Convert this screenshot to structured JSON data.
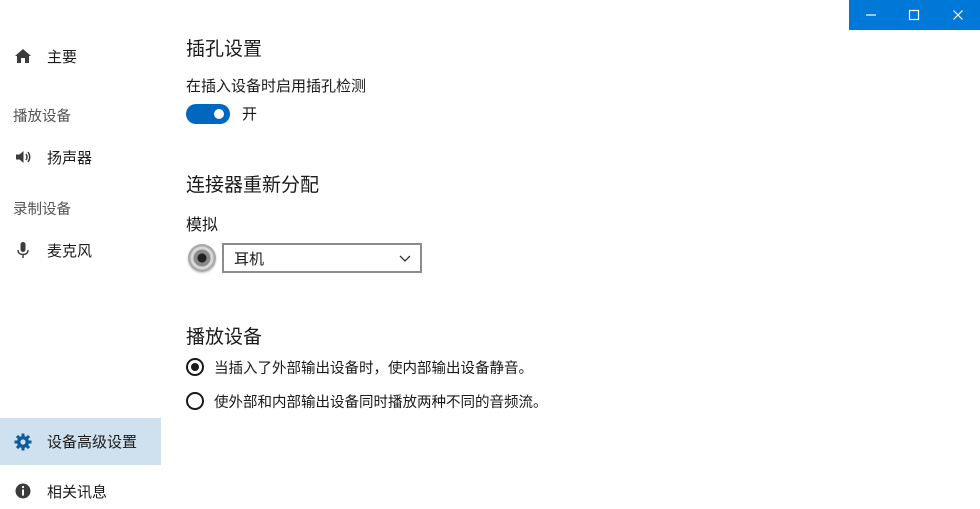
{
  "window": {
    "minimize_icon": "minimize-icon",
    "maximize_icon": "maximize-icon",
    "close_icon": "close-icon",
    "accent": "#0078d7"
  },
  "sidebar": {
    "home_label": "主要",
    "playback_section": "播放设备",
    "speaker_label": "扬声器",
    "recording_section": "录制设备",
    "mic_label": "麦克风",
    "advanced_label": "设备高级设置",
    "related_label": "相关讯息"
  },
  "jack_settings": {
    "title": "插孔设置",
    "detect_label": "在插入设备时启用插孔检测",
    "toggle_state": "开",
    "toggle_on": true,
    "toggle_color": "#0067c0"
  },
  "connector": {
    "title": "连接器重新分配",
    "analog_label": "模拟",
    "selected_value": "耳机"
  },
  "playback": {
    "title": "播放设备",
    "options": [
      {
        "label": "当插入了外部输出设备时，使内部输出设备静音。",
        "checked": true
      },
      {
        "label": "使外部和内部输出设备同时播放两种不同的音频流。",
        "checked": false
      }
    ]
  }
}
